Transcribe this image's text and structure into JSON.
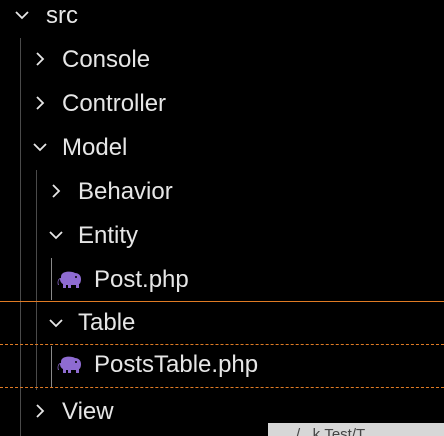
{
  "explorer": {
    "items": [
      {
        "label": "src",
        "type": "folder",
        "expanded": true,
        "depth": 0
      },
      {
        "label": "Console",
        "type": "folder",
        "expanded": false,
        "depth": 1
      },
      {
        "label": "Controller",
        "type": "folder",
        "expanded": false,
        "depth": 1
      },
      {
        "label": "Model",
        "type": "folder",
        "expanded": true,
        "depth": 1
      },
      {
        "label": "Behavior",
        "type": "folder",
        "expanded": false,
        "depth": 2
      },
      {
        "label": "Entity",
        "type": "folder",
        "expanded": true,
        "depth": 2
      },
      {
        "label": "Post.php",
        "type": "file",
        "icon": "php-elephant-icon",
        "depth": 3
      },
      {
        "label": "Table",
        "type": "folder",
        "expanded": true,
        "depth": 2
      },
      {
        "label": "PostsTable.php",
        "type": "file",
        "icon": "php-elephant-icon",
        "depth": 3,
        "selected": true
      },
      {
        "label": "View",
        "type": "folder",
        "expanded": false,
        "depth": 1
      }
    ]
  },
  "tooltip_fragment": "/...k.Test/T...",
  "colors": {
    "background": "#000000",
    "text": "#e6e6e6",
    "focus_outline": "#e07b24",
    "php_icon": "#8e6bd1",
    "indent_guide": "#4a4a4a"
  }
}
